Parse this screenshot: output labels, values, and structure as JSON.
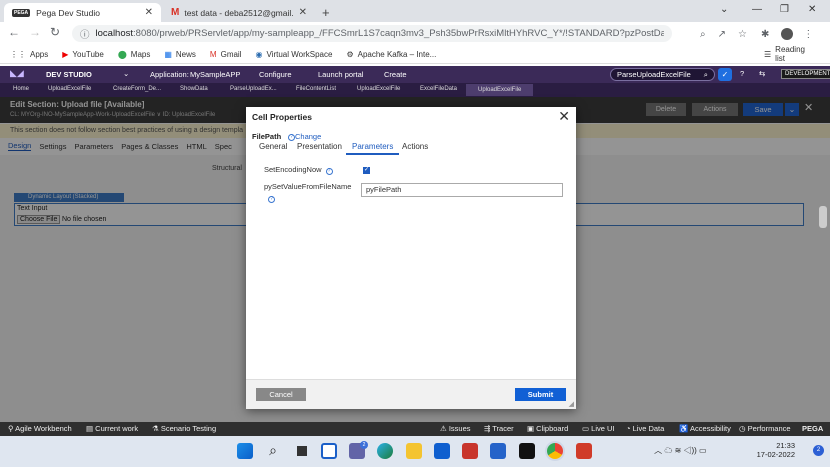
{
  "browser": {
    "tabs": [
      {
        "fav": "PEGA",
        "title": "Pega Dev Studio"
      },
      {
        "fav": "M",
        "title": "test data - deba2512@gmail.com"
      }
    ],
    "url_host": "localhost",
    "url_path": ":8080/prweb/PRServlet/app/my-sampleapp_/FFCSmrL1S7caqn3mv3_Psh35bwPrRsxiMltHYhRVC_Y*/!STANDARD?pzPostData=4040826",
    "bookmarks": [
      "Apps",
      "YouTube",
      "Maps",
      "News",
      "Gmail",
      "Virtual WorkSpace",
      "Apache Kafka – Inte..."
    ],
    "reading_list": "Reading list"
  },
  "pega": {
    "studio": "DEV STUDIO",
    "application_label": "Application:",
    "application": "MySampleAPP",
    "menus": [
      "Configure",
      "Launch portal",
      "Create"
    ],
    "search_value": "ParseUploadExcelFile",
    "env": "DEVELOPMENT",
    "subtabs": [
      "Home",
      "UploadExcelFile",
      "CreateForm_De...",
      "ShowData",
      "ParseUploadEx...",
      "FileContentList",
      "UploadExcelFile",
      "ExcelFileData",
      "UploadExcelFile"
    ],
    "edit_title": "Edit  Section: Upload file [Available]",
    "edit_sub": "CL:  MYOrg-INO-MySampleApp-Work-UploadExcelFile  ∨   ID:  UploadExcelFile",
    "warning": "This section does not follow section best practices of using a design templa",
    "design_tabs": [
      "Design",
      "Settings",
      "Parameters",
      "Pages & Classes",
      "HTML",
      "Spec"
    ],
    "structural": "Structural",
    "layout_tag": "Dynamic Layout (Stacked)",
    "text_input": "Text Input",
    "choose_file": "Choose File",
    "no_file": "No file chosen",
    "delete": "Delete",
    "actions": "Actions",
    "save": "Save"
  },
  "modal": {
    "title": "Cell Properties",
    "field": "FilePath",
    "change": "Change",
    "tabs": [
      "General",
      "Presentation",
      "Parameters",
      "Actions"
    ],
    "active_tab": "Parameters",
    "param1_label": "SetEncodingNow",
    "param1_checked": true,
    "param2_label": "pySetValueFromFileName",
    "param2_value": "pyFilePath",
    "cancel": "Cancel",
    "submit": "Submit"
  },
  "footer": {
    "left": [
      "Agile Workbench",
      "Current work",
      "Scenario Testing"
    ],
    "right": [
      "Issues",
      "Tracer",
      "Clipboard",
      "Live UI",
      "Live Data",
      "Accessibility",
      "Performance"
    ],
    "brand": "PEGA"
  },
  "taskbar": {
    "time": "21:33",
    "date": "17-02-2022",
    "badge": "2"
  }
}
